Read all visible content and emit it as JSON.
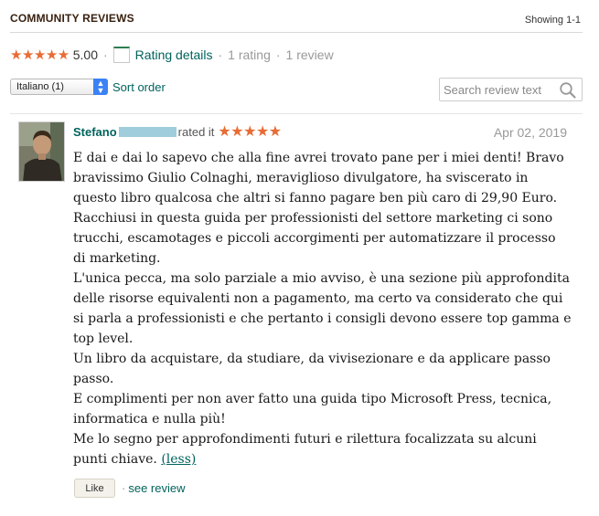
{
  "header": {
    "title": "COMMUNITY REVIEWS",
    "showing": "Showing 1-1"
  },
  "summary": {
    "stars": "★★★★★",
    "average": "5.00",
    "separator": "·",
    "rating_details_label": "Rating details",
    "rating_count": "1 rating",
    "review_count": "1 review",
    "star_color": "#e86c34",
    "link_color": "#00635d"
  },
  "filters": {
    "language_selected": "Italiano (1)",
    "sort_order_label": "Sort order",
    "search_placeholder": "Search review text"
  },
  "review": {
    "reviewer_name": "Stefano",
    "rated_it": "rated it",
    "stars": "★★★★★",
    "rating_value": 5,
    "date": "Apr 02, 2019",
    "paragraphs": [
      "E dai e dai lo sapevo che alla fine avrei trovato pane per i miei denti! Bravo bravissimo Giulio Colnaghi, meraviglioso divulgatore, ha sviscerato in questo libro qualcosa che altri si fanno pagare ben più caro di 29,90 Euro. Racchiusi in questa guida per professionisti del settore marketing ci sono trucchi, escamotages e piccoli accorgimenti per automatizzare il processo di marketing.",
      "L'unica pecca, ma solo parziale a mio avviso, è una sezione più approfondita delle risorse equivalenti non a pagamento, ma certo va considerato che qui si parla a professionisti e che pertanto i consigli devono essere top gamma e top level.",
      "Un libro da acquistare, da studiare, da vivisezionare e da applicare passo passo.",
      "E complimenti per non aver fatto una guida tipo Microsoft Press, tecnica, informatica e nulla più!",
      "Me lo segno per approfondimenti futuri e rilettura focalizzata su alcuni punti chiave."
    ],
    "less_label": "(less)",
    "like_label": "Like",
    "separator": "·",
    "see_review_label": "see review"
  }
}
